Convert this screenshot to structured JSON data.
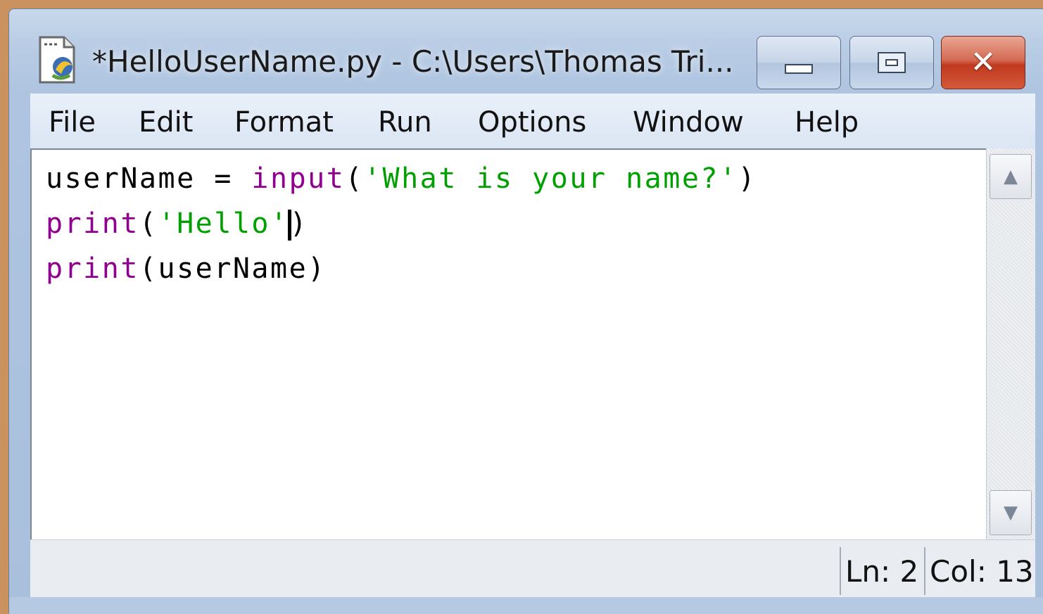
{
  "window": {
    "title": "*HelloUserName.py - C:\\Users\\Thomas Tri...",
    "icon": "python-file-icon",
    "controls": {
      "minimize_icon": "minimize-icon",
      "maximize_icon": "maximize-icon",
      "close_icon": "close-icon",
      "close_glyph": "✕"
    }
  },
  "menu": {
    "items": [
      "File",
      "Edit",
      "Format",
      "Run",
      "Options",
      "Window",
      "Help"
    ]
  },
  "editor": {
    "line1": {
      "a": "userName = ",
      "kw": "input",
      "b": "(",
      "str": "'What is your name?'",
      "c": ")"
    },
    "line2": {
      "kw": "print",
      "b": "(",
      "str": "'Hello'",
      "c": ")"
    },
    "line3": {
      "kw": "print",
      "rest": "(userName)"
    }
  },
  "scrollbar": {
    "up_glyph": "▲",
    "down_glyph": "▼"
  },
  "status": {
    "line": "Ln: 2",
    "column": "Col: 13"
  },
  "colors": {
    "keyword": "#900090",
    "string": "#00a000",
    "desktop": "#c9925f"
  }
}
